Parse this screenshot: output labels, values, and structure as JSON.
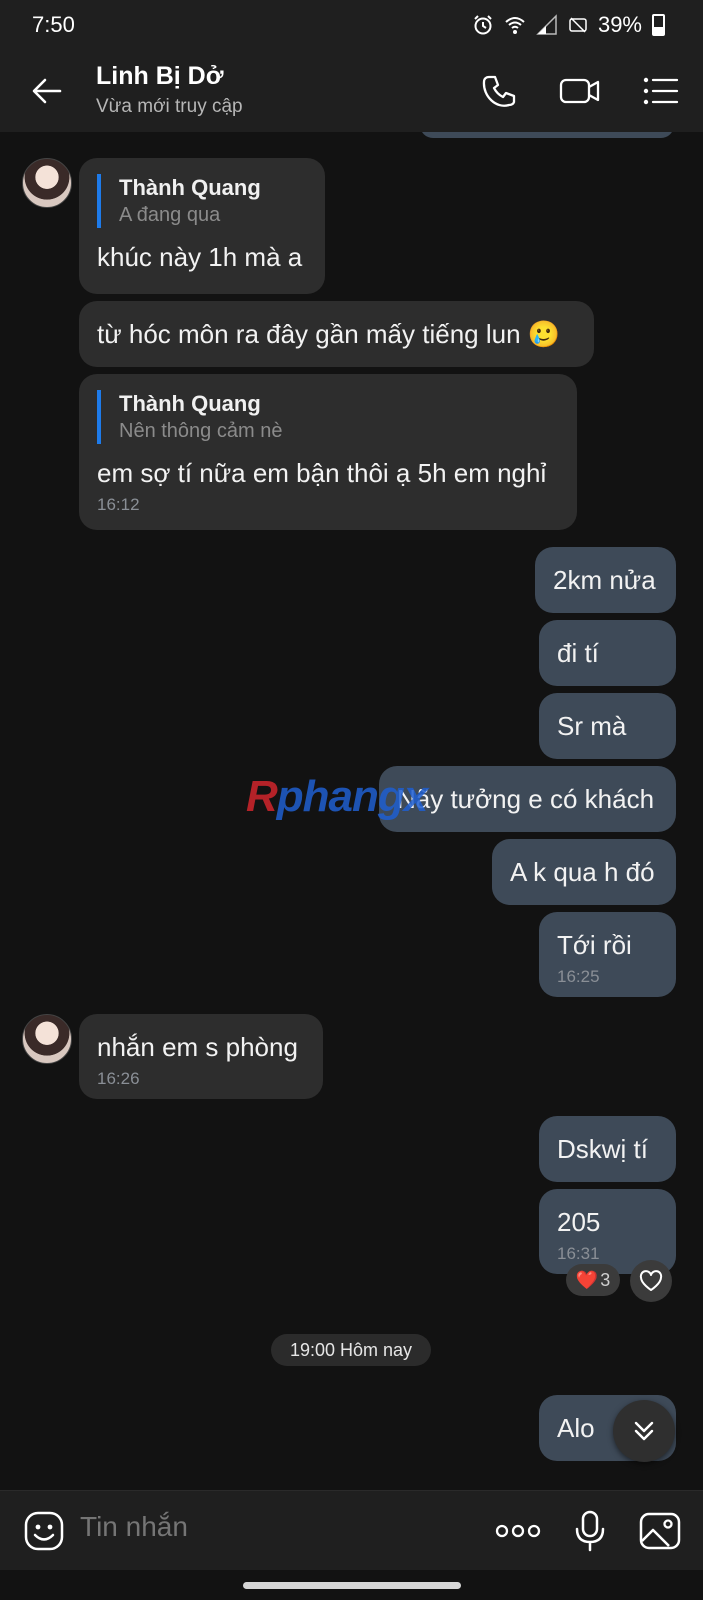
{
  "status_bar": {
    "time": "7:50",
    "battery": "39%",
    "battery_level": 0.39,
    "icons": [
      "alarm-icon",
      "wifi-icon",
      "signal-icon",
      "no-sim-icon",
      "battery-icon"
    ]
  },
  "header": {
    "title": "Linh Bị Dở",
    "subtitle": "Vừa mới truy cập",
    "icons": [
      "back-arrow-icon",
      "phone-icon",
      "video-call-icon",
      "menu-icon"
    ]
  },
  "messages": [
    {
      "dir": "in",
      "quote_name": "Thành Quang",
      "quote_text": "A đang qua",
      "text": "khúc này 1h mà a"
    },
    {
      "dir": "in",
      "text": "từ hóc môn ra đây gần mấy tiếng lun 🥲"
    },
    {
      "dir": "in",
      "quote_name": "Thành Quang",
      "quote_text": "Nên thông cảm nè",
      "text": "em sợ tí nữa em bận thôi ạ 5h em nghỉ",
      "time": "16:12"
    },
    {
      "dir": "out",
      "text": "2km nửa"
    },
    {
      "dir": "out",
      "text": "đi tí"
    },
    {
      "dir": "out",
      "text": "Sr mà"
    },
    {
      "dir": "out",
      "text": "Nãy tưởng e có khách"
    },
    {
      "dir": "out",
      "text": "A k qua h đó"
    },
    {
      "dir": "out",
      "text": "Tới rồi",
      "time": "16:25"
    },
    {
      "dir": "in",
      "text": "nhắn em s phòng",
      "time": "16:26"
    },
    {
      "dir": "out",
      "text": "Dskwị tí"
    },
    {
      "dir": "out",
      "text": "205",
      "time": "16:31"
    },
    {
      "dir": "out",
      "text": "Alo"
    }
  ],
  "reaction": {
    "emoji": "❤️",
    "count": "3"
  },
  "date_divider": "19:00 Hôm nay",
  "watermark": {
    "part1": "R",
    "part2": "phangx"
  },
  "input": {
    "placeholder": "Tin nhắn",
    "icons": [
      "sticker-icon",
      "more-dots-icon",
      "microphone-icon",
      "image-icon"
    ]
  },
  "colors": {
    "background": "#121212",
    "bar": "#1f1f1f",
    "incoming_bubble": "#2d2d2d",
    "outgoing_bubble": "#3e4a58",
    "quote_accent": "#1e7bea"
  }
}
